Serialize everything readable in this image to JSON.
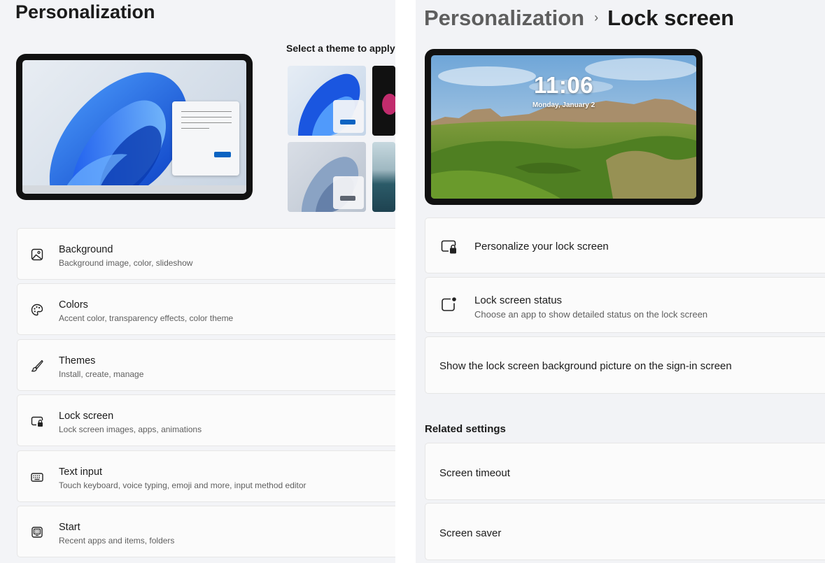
{
  "left": {
    "title": "Personalization",
    "theme_select_label": "Select a theme to apply",
    "themes": [
      {
        "icon": "bloom-blue-theme"
      },
      {
        "icon": "dark-flower-theme"
      },
      {
        "icon": "light-bloom-theme"
      },
      {
        "icon": "lake-landscape-theme"
      }
    ],
    "items": [
      {
        "title": "Background",
        "subtitle": "Background image, color, slideshow",
        "icon": "image-icon"
      },
      {
        "title": "Colors",
        "subtitle": "Accent color, transparency effects, color theme",
        "icon": "palette-icon"
      },
      {
        "title": "Themes",
        "subtitle": "Install, create, manage",
        "icon": "brush-icon"
      },
      {
        "title": "Lock screen",
        "subtitle": "Lock screen images, apps, animations",
        "icon": "lock-screen-icon"
      },
      {
        "title": "Text input",
        "subtitle": "Touch keyboard, voice typing, emoji and more, input method editor",
        "icon": "keyboard-icon"
      },
      {
        "title": "Start",
        "subtitle": "Recent apps and items, folders",
        "icon": "start-icon"
      }
    ]
  },
  "right": {
    "breadcrumb": {
      "parent": "Personalization",
      "separator": "›",
      "current": "Lock screen"
    },
    "preview": {
      "time": "11:06",
      "date": "Monday, January 2"
    },
    "items": [
      {
        "title": "Personalize your lock screen",
        "icon": "lock-screen-icon"
      },
      {
        "title": "Lock screen status",
        "subtitle": "Choose an app to show detailed status on the lock screen",
        "icon": "status-icon"
      },
      {
        "title": "Show the lock screen background picture on the sign-in screen"
      }
    ],
    "related_heading": "Related settings",
    "related_items": [
      {
        "title": "Screen timeout"
      },
      {
        "title": "Screen saver"
      }
    ]
  },
  "colors": {
    "accent": "#0a63c2",
    "panel_bg": "#f3f4f7",
    "card_bg": "#fbfbfb"
  }
}
